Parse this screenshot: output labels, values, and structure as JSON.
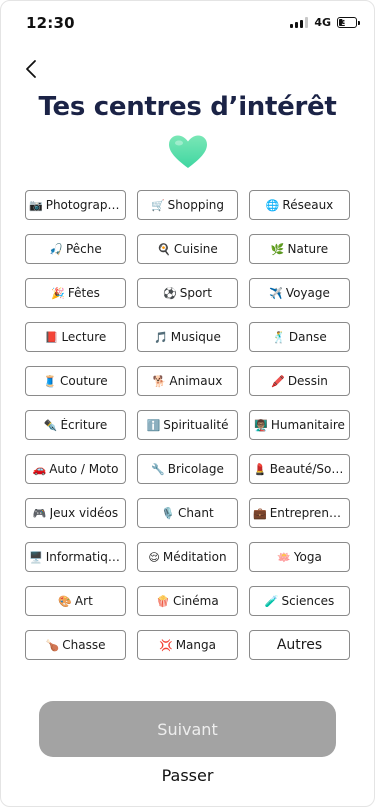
{
  "status_bar": {
    "time": "12:30",
    "network": "4G",
    "battery": "38",
    "battery_level": 0.38
  },
  "header": {
    "back_icon": "chevron-left-icon",
    "title": "Tes centres d’intérêt",
    "heart_icon": "green-heart-icon",
    "heart_gradient": [
      "#7ae7b6",
      "#3fd6a1"
    ]
  },
  "interests": [
    {
      "emoji": "📷",
      "label": "Photographie"
    },
    {
      "emoji": "🛒",
      "label": "Shopping"
    },
    {
      "emoji": "🌐",
      "label": "Réseaux"
    },
    {
      "emoji": "🎣",
      "label": "Pêche"
    },
    {
      "emoji": "🍳",
      "label": "Cuisine"
    },
    {
      "emoji": "🌿",
      "label": "Nature"
    },
    {
      "emoji": "🎉",
      "label": "Fêtes"
    },
    {
      "emoji": "⚽",
      "label": "Sport"
    },
    {
      "emoji": "✈️",
      "label": "Voyage"
    },
    {
      "emoji": "📕",
      "label": "Lecture"
    },
    {
      "emoji": "🎵",
      "label": "Musique"
    },
    {
      "emoji": "🕺",
      "label": "Danse"
    },
    {
      "emoji": "🧵",
      "label": "Couture"
    },
    {
      "emoji": "🐕",
      "label": "Animaux"
    },
    {
      "emoji": "🖍️",
      "label": "Dessin"
    },
    {
      "emoji": "✒️",
      "label": "Écriture"
    },
    {
      "emoji": "ℹ️",
      "label": "Spiritualité"
    },
    {
      "emoji": "👨🏽‍🏫",
      "label": "Humanitaire"
    },
    {
      "emoji": "🚗",
      "label": "Auto / Moto"
    },
    {
      "emoji": "🔧",
      "label": "Bricolage"
    },
    {
      "emoji": "💄",
      "label": "Beauté/Soins"
    },
    {
      "emoji": "🎮",
      "label": "Jeux vidéos"
    },
    {
      "emoji": "🎙️",
      "label": "Chant"
    },
    {
      "emoji": "💼",
      "label": "Entreprena..."
    },
    {
      "emoji": "🖥️",
      "label": "Informatique"
    },
    {
      "emoji": "😌",
      "label": "Méditation"
    },
    {
      "emoji": "🪷",
      "label": "Yoga"
    },
    {
      "emoji": "🎨",
      "label": "Art"
    },
    {
      "emoji": "🍿",
      "label": "Cinéma"
    },
    {
      "emoji": "🧪",
      "label": "Sciences"
    },
    {
      "emoji": "🍗",
      "label": "Chasse"
    },
    {
      "emoji": "💢",
      "label": "Manga"
    },
    {
      "emoji": "",
      "label": "Autres"
    }
  ],
  "footer": {
    "next_label": "Suivant",
    "skip_label": "Passer"
  },
  "colors": {
    "title": "#1b2346",
    "chip_border": "#8a8a8a",
    "next_button_bg": "#a3a3a3",
    "next_button_text": "#eeeeee"
  }
}
